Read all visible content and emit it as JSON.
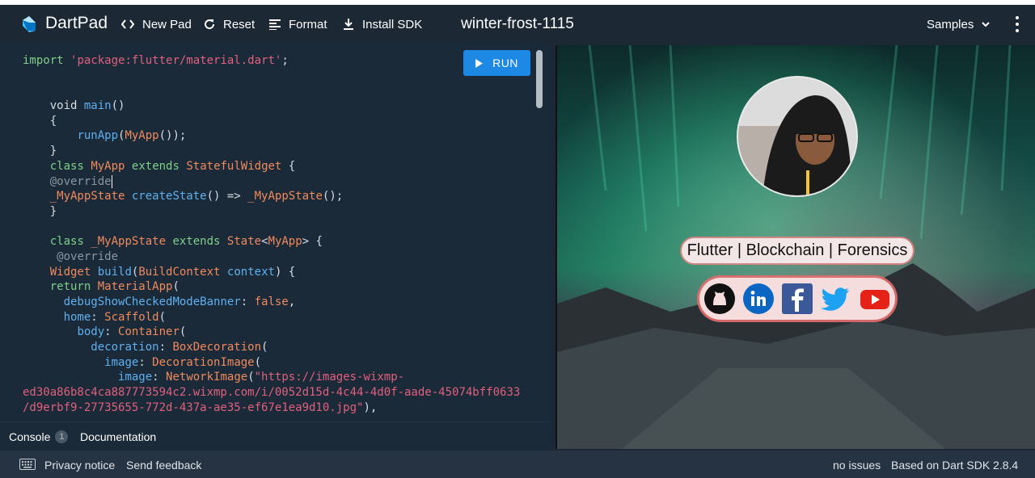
{
  "header": {
    "app_name": "DartPad",
    "new_pad": "New Pad",
    "reset": "Reset",
    "format": "Format",
    "install_sdk": "Install SDK",
    "pad_title": "winter-frost-1115",
    "samples": "Samples"
  },
  "editor": {
    "run_label": "RUN"
  },
  "output": {
    "tagline": "Flutter | Blockchain | Forensics",
    "social_icons": [
      "github-icon",
      "linkedin-icon",
      "facebook-icon",
      "twitter-icon",
      "youtube-icon"
    ]
  },
  "console": {
    "console_label": "Console",
    "console_count": "1",
    "documentation_label": "Documentation"
  },
  "footer": {
    "privacy": "Privacy notice",
    "feedback": "Send feedback",
    "issues": "no issues",
    "sdk": "Based on Dart SDK 2.8.4"
  },
  "colors": {
    "run_button": "#1e88e5",
    "header_bg": "#1c2834",
    "editor_bg": "#1b2a38"
  }
}
